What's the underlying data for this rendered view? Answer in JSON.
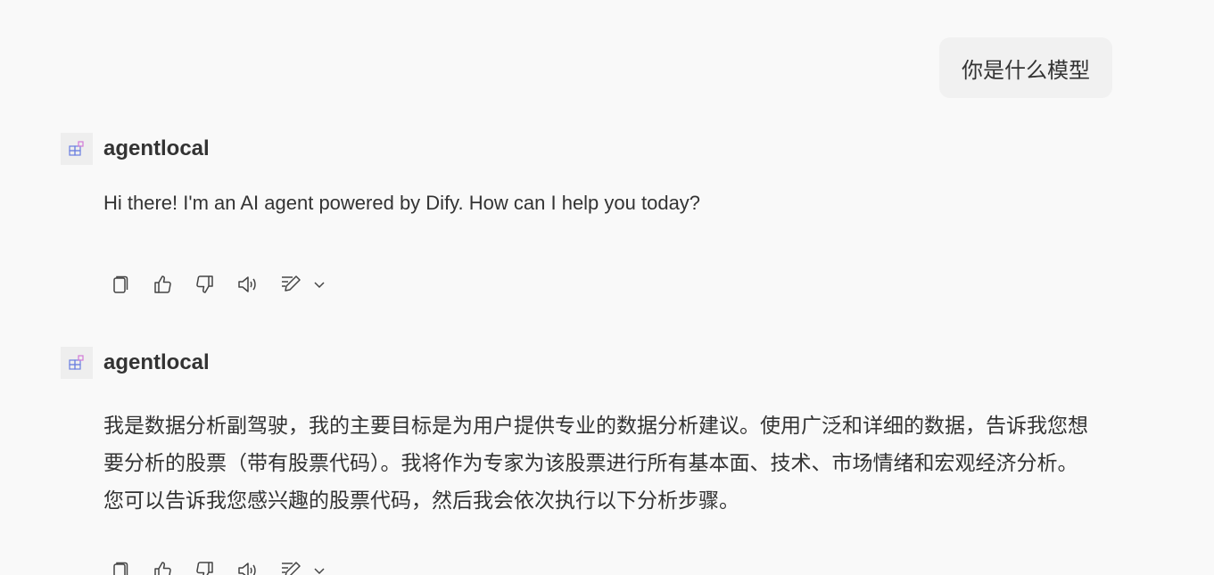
{
  "chat": {
    "user_message": "你是什么模型",
    "messages": [
      {
        "agent_name": "agentlocal",
        "text": "Hi there! I'm an AI agent powered by Dify. How can I help you today?"
      },
      {
        "agent_name": "agentlocal",
        "text_lines": [
          "我是数据分析副驾驶，我的主要目标是为用户提供专业的数据分析建议。使用广泛和详细的数据，告诉我您想",
          "要分析的股票（带有股票代码）。我将作为专家为该股票进行所有基本面、技术、市场情绪和宏观经济分析。",
          "您可以告诉我您感兴趣的股票代码，然后我会依次执行以下分析步骤。"
        ]
      }
    ]
  },
  "icons": {
    "avatar": "app-grid-icon",
    "copy": "copy-icon",
    "like": "thumbs-up-icon",
    "dislike": "thumbs-down-icon",
    "speak": "speaker-icon",
    "edit": "edit-icon",
    "more": "chevron-down-icon"
  },
  "colors": {
    "background": "#f9f9f9",
    "user_bubble": "#f1f1f1",
    "avatar_bg": "#eeeeee",
    "avatar_icon": "#6b7fe0",
    "text": "#333333"
  }
}
